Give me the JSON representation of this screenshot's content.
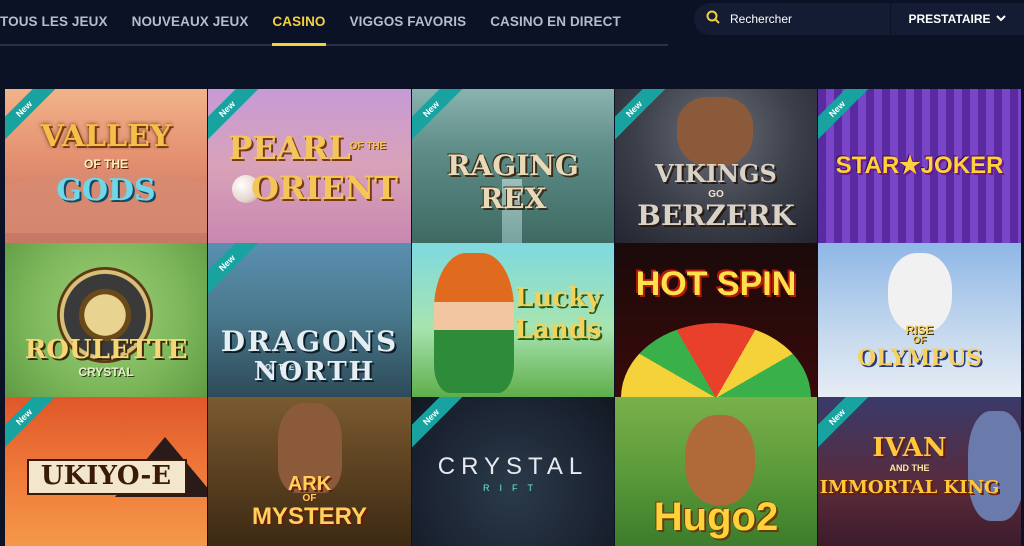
{
  "nav": {
    "tabs": [
      "TOUS LES JEUX",
      "NOUVEAUX JEUX",
      "CASINO",
      "VIGGOS FAVORIS",
      "CASINO EN DIRECT"
    ],
    "active": "CASINO"
  },
  "search": {
    "placeholder": "Rechercher"
  },
  "provider": {
    "label": "PRESTATAIRE"
  },
  "badge_new": "New",
  "games": [
    {
      "line1": "VALLEY",
      "line2": "OF THE",
      "line3": "GODS",
      "new": true
    },
    {
      "line1": "PEARL",
      "line2": "OF THE",
      "line3": "ORIENT",
      "new": true
    },
    {
      "line1": "RAGING REX",
      "new": true
    },
    {
      "line1": "VIKINGS",
      "line2": "GO",
      "line3": "BERZERK",
      "new": true
    },
    {
      "line1": "STAR★JOKER",
      "new": true
    },
    {
      "line1": "ROULETTE",
      "line2": "CRYSTAL",
      "new": false
    },
    {
      "line1": "DRAGONS",
      "line2": "OF THE",
      "line3": "NORTH",
      "new": true
    },
    {
      "line1": "Lucky",
      "line2": "Lands",
      "new": false
    },
    {
      "line1": "HOT SPIN",
      "new": false
    },
    {
      "line1": "RISE",
      "line2": "OF",
      "line3": "OLYMPUS",
      "new": false
    },
    {
      "line1": "UKIYO-E",
      "new": true
    },
    {
      "line1": "ARK",
      "line2": "OF",
      "line3": "MYSTERY",
      "new": false
    },
    {
      "line1": "CRYSTAL",
      "line2": "RIFT",
      "new": true
    },
    {
      "line1": "Hugo2",
      "new": false
    },
    {
      "line1": "IVAN",
      "line2": "AND THE",
      "line3": "IMMORTAL KING",
      "new": true
    }
  ]
}
